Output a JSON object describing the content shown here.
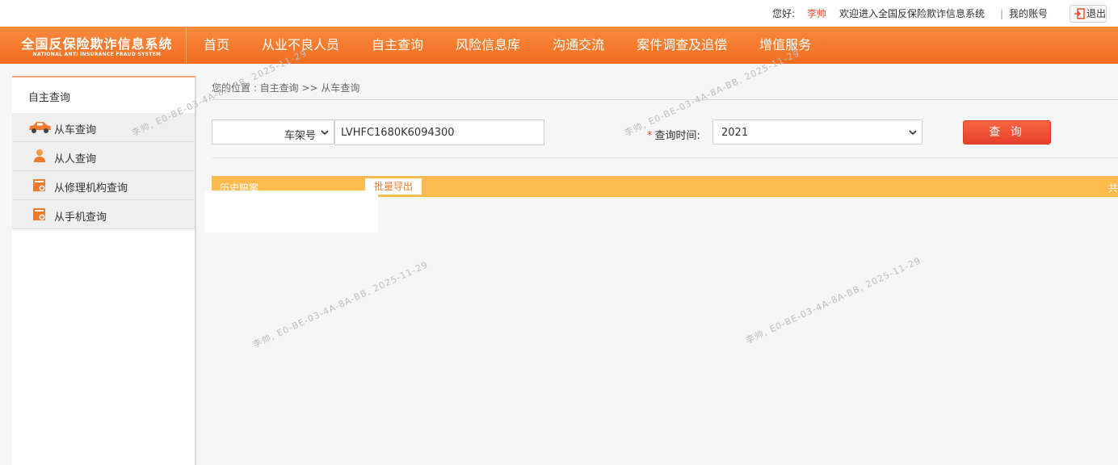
{
  "topbar": {
    "greeting": "您好:",
    "user_name": "李帅",
    "welcome": "欢迎进入全国反保险欺诈信息系统",
    "separator": "|",
    "my_account": "我的账号",
    "logout": "退出"
  },
  "brand": {
    "title_cn": "全国反保险欺诈信息系统",
    "title_en": "NATIONAL ANTI INSURANCE FRAUD SYSTEM"
  },
  "nav": {
    "items": [
      "首页",
      "从业不良人员",
      "自主查询",
      "风险信息库",
      "沟通交流",
      "案件调查及追偿",
      "增值服务"
    ]
  },
  "sidebar": {
    "title": "自主查询",
    "items": [
      {
        "label": "从车查询",
        "icon": "car-icon"
      },
      {
        "label": "从人查询",
        "icon": "person-icon"
      },
      {
        "label": "从修理机构查询",
        "icon": "repair-shop-icon"
      },
      {
        "label": "从手机查询",
        "icon": "phone-icon"
      }
    ]
  },
  "breadcrumb": "您的位置 : 自主查询 >> 从车查询",
  "search": {
    "type_selected": "车架号",
    "vin_value": "LVHFC1680K6094300",
    "time_label": "查询时间:",
    "required_mark": "*",
    "year_selected": "2021",
    "query_button": "查 询"
  },
  "results": {
    "tab_label": "历史赔案",
    "export_button": "批量导出",
    "total_prefix": "共"
  },
  "watermark": {
    "text": "李帅, E0-BE-03-4A-8A-BB, 2025-11-29"
  },
  "colors": {
    "brand_orange": "#f26d22",
    "result_bar": "#fdbb4d",
    "query_button": "#e8412a",
    "username": "#e8532c"
  }
}
